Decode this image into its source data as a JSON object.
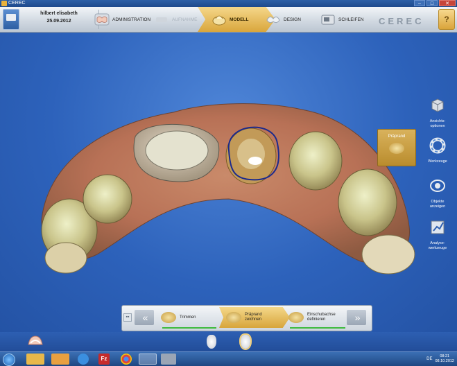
{
  "window": {
    "title": "CEREC",
    "controls": [
      "–",
      "□",
      "✕"
    ]
  },
  "patient": {
    "name": "hilbert elisabeth",
    "date": "25.09.2012"
  },
  "workflow": {
    "steps": [
      {
        "label": "ADMINISTRATION",
        "state": "done"
      },
      {
        "label": "AUFNAHME",
        "state": "disabled"
      },
      {
        "label": "MODELL",
        "state": "active"
      },
      {
        "label": "DESIGN",
        "state": "todo"
      },
      {
        "label": "SCHLEIFEN",
        "state": "todo"
      }
    ]
  },
  "brand": "CEREC",
  "side_tools": {
    "panel": {
      "label": "Präprand"
    },
    "items": [
      {
        "label": "Ansichts-\noptionen",
        "icon": "view-options-icon"
      },
      {
        "label": "Werkzeuge",
        "icon": "tools-ring-icon"
      },
      {
        "label": "Objekte\nanzeigen",
        "icon": "objects-icon"
      },
      {
        "label": "Analyse-\nwerkzeuge",
        "icon": "analysis-icon"
      }
    ]
  },
  "step_bar": {
    "mini": "▪▪",
    "prev": "«",
    "next": "»",
    "steps": [
      {
        "label": "Trimmen",
        "state": "done"
      },
      {
        "label": "Präprand\nzeichnen",
        "state": "active"
      },
      {
        "label": "Einschubachse\ndefinieren",
        "state": "todo"
      }
    ]
  },
  "taskbar": {
    "lang": "DE",
    "time": "08:21",
    "date": "08.10.2012"
  },
  "colors": {
    "accent": "#d9a63c",
    "viewport": "#2d62bb",
    "margin_line": "#1c2a8c"
  }
}
